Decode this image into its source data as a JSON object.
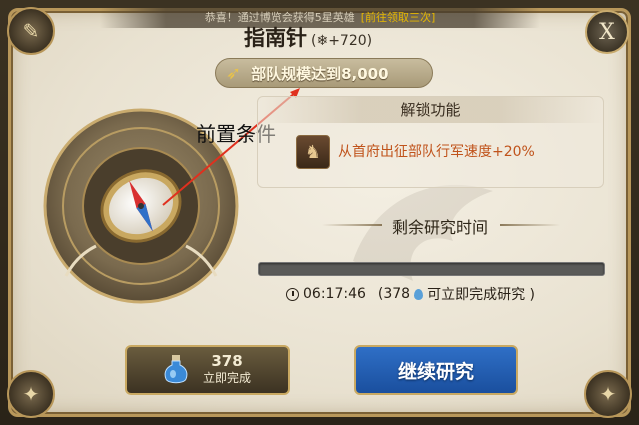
{
  "header": {
    "banner_text": "恭喜！通过博览会获得5星英雄",
    "banner_highlight": "[前往领取三次]",
    "close_label": "X"
  },
  "research": {
    "name": "指南针",
    "bonus": "(❄+720)",
    "prerequisite": "部队规模达到8,000",
    "annotation": "前置条件"
  },
  "unlock": {
    "heading": "解锁功能",
    "effect": "从首府出征部队行军速度+20%"
  },
  "remaining": {
    "label": "剩余研究时间",
    "progress_fraction": 0.0,
    "time": "06:17:46",
    "cost_prefix": "(378",
    "cost_suffix": "可立即完成研究 )"
  },
  "buttons": {
    "instant_amount": "378",
    "instant_label": "立即完成",
    "continue_label": "继续研究"
  },
  "colors": {
    "frame_gold": "#b8975a",
    "effect_orange": "#c0531b",
    "continue_blue": "#2f6fc6",
    "arrow_red": "#e0301e"
  },
  "icons": [
    "scroll-icon",
    "close-icon",
    "arrow-icon",
    "compass-icon",
    "horse-icon",
    "clock-icon",
    "water-drop-icon",
    "potion-icon"
  ]
}
